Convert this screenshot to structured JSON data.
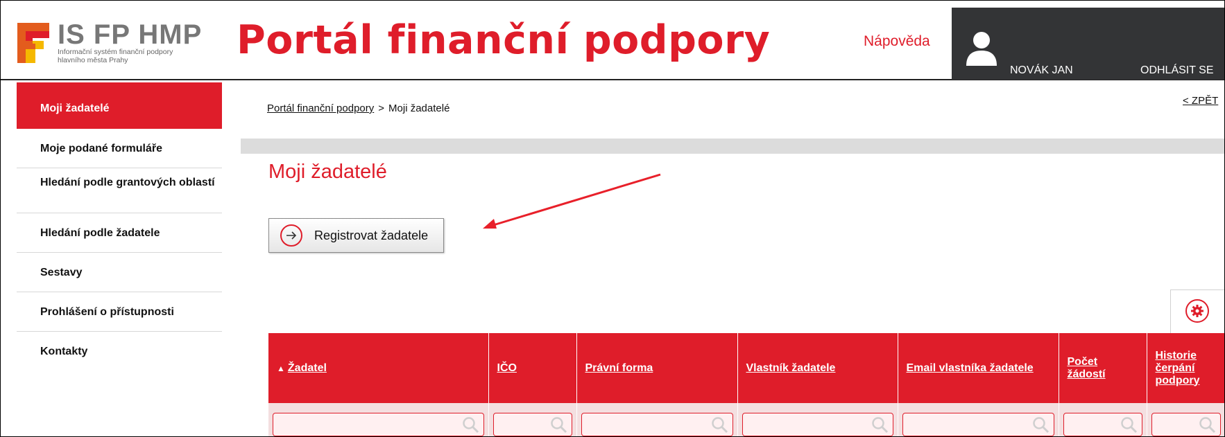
{
  "header": {
    "logo_title": "IS FP HMP",
    "logo_subtitle": "Informační systém finanční podpory hlavního města Prahy",
    "portal_title": "Portál finanční podpory",
    "help_label": "Nápověda",
    "user_name": "NOVÁK JAN",
    "logout_label": "ODHLÁSIT SE"
  },
  "sidebar": {
    "items": [
      {
        "label": "Moji žadatelé",
        "active": true
      },
      {
        "label": "Moje podané formuláře"
      },
      {
        "label": "Hledání podle grantových oblastí"
      },
      {
        "label": "Hledání podle žadatele"
      },
      {
        "label": "Sestavy"
      },
      {
        "label": "Prohlášení o přístupnosti"
      },
      {
        "label": "Kontakty"
      }
    ]
  },
  "breadcrumb": {
    "root": "Portál finanční podpory",
    "separator": ">",
    "current": "Moji žadatelé"
  },
  "back_label": "< ZPĚT",
  "page_title": "Moji žadatelé",
  "register_button": "Registrovat žadatele",
  "table": {
    "columns": [
      {
        "label": "Žadatel",
        "sorted": "asc"
      },
      {
        "label": "IČO"
      },
      {
        "label": "Právní forma"
      },
      {
        "label": "Vlastník žadatele"
      },
      {
        "label": "Email vlastníka žadatele"
      },
      {
        "label": "Počet žádostí"
      },
      {
        "label": "Historie čerpání podpory"
      }
    ]
  },
  "colors": {
    "brand_red": "#df1d2a",
    "user_panel": "#333436",
    "gray_bar": "#dcdcdc"
  },
  "icons": {
    "register": "circle-arrow-right-icon",
    "settings": "gear-icon",
    "filter": "search-icon",
    "user": "user-icon"
  }
}
